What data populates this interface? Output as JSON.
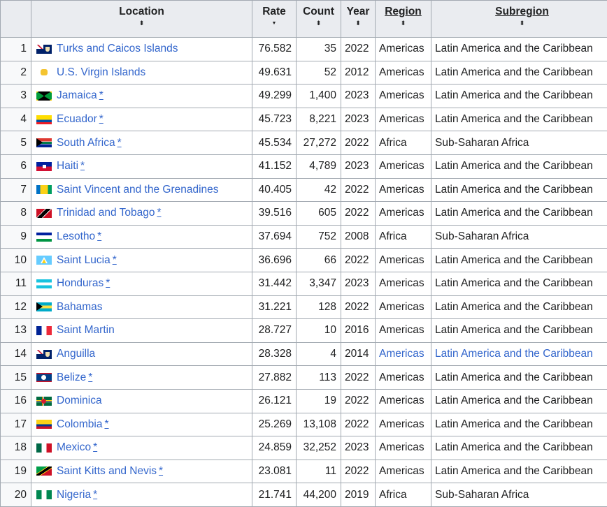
{
  "headers": {
    "location": "Location",
    "rate": "Rate",
    "count": "Count",
    "year": "Year",
    "region": "Region",
    "subregion": "Subregion",
    "sort_icon": "⬍",
    "sort_desc_icon": "▼"
  },
  "rows": [
    {
      "n": "1",
      "flag": "turks-caicos",
      "location": "Turks and Caicos Islands",
      "note": "",
      "rate": "76.582",
      "count": "35",
      "year": "2022",
      "region": "Americas",
      "subregion": "Latin America and the Caribbean",
      "linked": false
    },
    {
      "n": "2",
      "flag": "us-virgin",
      "location": "U.S. Virgin Islands",
      "note": "",
      "rate": "49.631",
      "count": "52",
      "year": "2012",
      "region": "Americas",
      "subregion": "Latin America and the Caribbean",
      "linked": false
    },
    {
      "n": "3",
      "flag": "jamaica",
      "location": "Jamaica",
      "note": "*",
      "rate": "49.299",
      "count": "1,400",
      "year": "2023",
      "region": "Americas",
      "subregion": "Latin America and the Caribbean",
      "linked": false
    },
    {
      "n": "4",
      "flag": "ecuador",
      "location": "Ecuador",
      "note": "*",
      "rate": "45.723",
      "count": "8,221",
      "year": "2023",
      "region": "Americas",
      "subregion": "Latin America and the Caribbean",
      "linked": false
    },
    {
      "n": "5",
      "flag": "south-africa",
      "location": "South Africa",
      "note": "*",
      "rate": "45.534",
      "count": "27,272",
      "year": "2022",
      "region": "Africa",
      "subregion": "Sub-Saharan Africa",
      "linked": false
    },
    {
      "n": "6",
      "flag": "haiti",
      "location": "Haiti",
      "note": "*",
      "rate": "41.152",
      "count": "4,789",
      "year": "2023",
      "region": "Americas",
      "subregion": "Latin America and the Caribbean",
      "linked": false
    },
    {
      "n": "7",
      "flag": "st-vincent",
      "location": "Saint Vincent and the Grenadines",
      "note": "",
      "rate": "40.405",
      "count": "42",
      "year": "2022",
      "region": "Americas",
      "subregion": "Latin America and the Caribbean",
      "linked": false
    },
    {
      "n": "8",
      "flag": "trinidad",
      "location": "Trinidad and Tobago",
      "note": "*",
      "rate": "39.516",
      "count": "605",
      "year": "2022",
      "region": "Americas",
      "subregion": "Latin America and the Caribbean",
      "linked": false
    },
    {
      "n": "9",
      "flag": "lesotho",
      "location": "Lesotho",
      "note": "*",
      "rate": "37.694",
      "count": "752",
      "year": "2008",
      "region": "Africa",
      "subregion": "Sub-Saharan Africa",
      "linked": false
    },
    {
      "n": "10",
      "flag": "st-lucia",
      "location": "Saint Lucia",
      "note": "*",
      "rate": "36.696",
      "count": "66",
      "year": "2022",
      "region": "Americas",
      "subregion": "Latin America and the Caribbean",
      "linked": false
    },
    {
      "n": "11",
      "flag": "honduras",
      "location": "Honduras",
      "note": "*",
      "rate": "31.442",
      "count": "3,347",
      "year": "2023",
      "region": "Americas",
      "subregion": "Latin America and the Caribbean",
      "linked": false
    },
    {
      "n": "12",
      "flag": "bahamas",
      "location": "Bahamas",
      "note": "",
      "rate": "31.221",
      "count": "128",
      "year": "2022",
      "region": "Americas",
      "subregion": "Latin America and the Caribbean",
      "linked": false
    },
    {
      "n": "13",
      "flag": "saint-martin",
      "location": "Saint Martin",
      "note": "",
      "rate": "28.727",
      "count": "10",
      "year": "2016",
      "region": "Americas",
      "subregion": "Latin America and the Caribbean",
      "linked": false
    },
    {
      "n": "14",
      "flag": "anguilla",
      "location": "Anguilla",
      "note": "",
      "rate": "28.328",
      "count": "4",
      "year": "2014",
      "region": "Americas",
      "subregion": "Latin America and the Caribbean",
      "linked": true
    },
    {
      "n": "15",
      "flag": "belize",
      "location": "Belize",
      "note": "*",
      "rate": "27.882",
      "count": "113",
      "year": "2022",
      "region": "Americas",
      "subregion": "Latin America and the Caribbean",
      "linked": false
    },
    {
      "n": "16",
      "flag": "dominica",
      "location": "Dominica",
      "note": "",
      "rate": "26.121",
      "count": "19",
      "year": "2022",
      "region": "Americas",
      "subregion": "Latin America and the Caribbean",
      "linked": false
    },
    {
      "n": "17",
      "flag": "colombia",
      "location": "Colombia",
      "note": "*",
      "rate": "25.269",
      "count": "13,108",
      "year": "2022",
      "region": "Americas",
      "subregion": "Latin America and the Caribbean",
      "linked": false
    },
    {
      "n": "18",
      "flag": "mexico",
      "location": "Mexico",
      "note": "*",
      "rate": "24.859",
      "count": "32,252",
      "year": "2023",
      "region": "Americas",
      "subregion": "Latin America and the Caribbean",
      "linked": false
    },
    {
      "n": "19",
      "flag": "st-kitts",
      "location": "Saint Kitts and Nevis",
      "note": "*",
      "rate": "23.081",
      "count": "11",
      "year": "2022",
      "region": "Americas",
      "subregion": "Latin America and the Caribbean",
      "linked": false
    },
    {
      "n": "20",
      "flag": "nigeria",
      "location": "Nigeria",
      "note": "*",
      "rate": "21.741",
      "count": "44,200",
      "year": "2019",
      "region": "Africa",
      "subregion": "Sub-Saharan Africa",
      "linked": false
    }
  ],
  "flag_colors": {
    "turks-caicos": [
      "#012169",
      "#c8102e"
    ],
    "us-virgin": [
      "#ffffff",
      "#f4c430"
    ],
    "jamaica": [
      "#009b3a",
      "#fed100",
      "#000000"
    ],
    "ecuador": [
      "#ffdd00",
      "#034ea2",
      "#ed1c24"
    ],
    "south-africa": [
      "#007a4d",
      "#000000",
      "#ffb612",
      "#de3831",
      "#002395"
    ],
    "haiti": [
      "#00209f",
      "#d21034"
    ],
    "st-vincent": [
      "#0072c6",
      "#fcd116",
      "#009e60"
    ],
    "trinidad": [
      "#ce1126",
      "#000000",
      "#ffffff"
    ],
    "lesotho": [
      "#00209f",
      "#ffffff",
      "#009543"
    ],
    "st-lucia": [
      "#66ccff",
      "#fcd116",
      "#000000"
    ],
    "honduras": [
      "#18c3df",
      "#ffffff"
    ],
    "bahamas": [
      "#00abc9",
      "#fae042",
      "#000000"
    ],
    "saint-martin": [
      "#002395",
      "#ffffff",
      "#ed2939"
    ],
    "anguilla": [
      "#012169",
      "#c8102e"
    ],
    "belize": [
      "#003f87",
      "#ce1126",
      "#ffffff"
    ],
    "dominica": [
      "#006b3f",
      "#fcd116",
      "#d41c30"
    ],
    "colombia": [
      "#fcd116",
      "#003893",
      "#ce1126"
    ],
    "mexico": [
      "#006847",
      "#ffffff",
      "#ce1126"
    ],
    "st-kitts": [
      "#009e49",
      "#000000",
      "#ce1126",
      "#fcd116"
    ],
    "nigeria": [
      "#008751",
      "#ffffff"
    ]
  }
}
